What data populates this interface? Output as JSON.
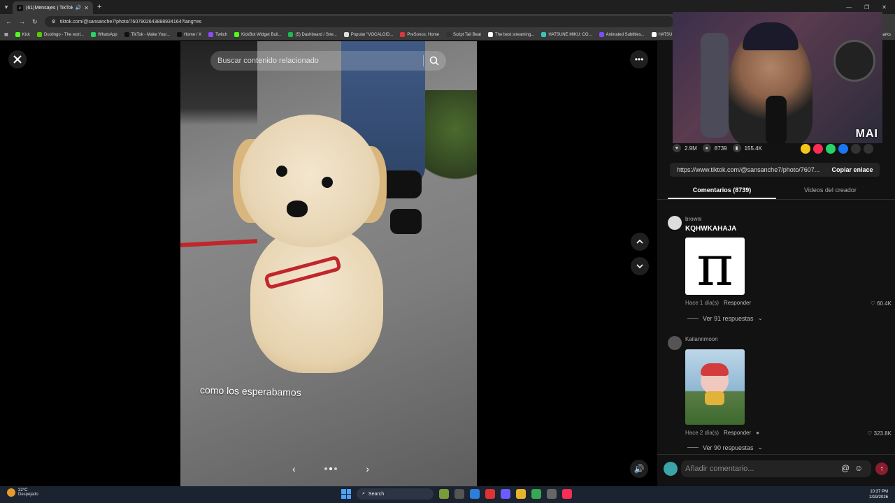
{
  "browser": {
    "tab_title": "(61)Mensajes | TikTok",
    "url": "tiktok.com/@sansanche7/photo/7607902643888934164?lang=es",
    "bookmarks": [
      {
        "label": "Kick",
        "color": "#53fc18"
      },
      {
        "label": "Duolingo - The worl...",
        "color": "#58cc02"
      },
      {
        "label": "WhatsApp",
        "color": "#25d366"
      },
      {
        "label": "TikTok - Make Your...",
        "color": "#111111"
      },
      {
        "label": "Home / X",
        "color": "#111111"
      },
      {
        "label": "Twitch",
        "color": "#9146ff"
      },
      {
        "label": "KickBot Widget Buil...",
        "color": "#53fc18"
      },
      {
        "label": "(5) Dashboard / Stre...",
        "color": "#1db954"
      },
      {
        "label": "Popular \"VOCALOID...",
        "color": "#dddddd"
      },
      {
        "label": "PreSonus: Home",
        "color": "#e0363b"
      },
      {
        "label": "Script Tail Beat",
        "color": "#333333"
      },
      {
        "label": "The best streaming...",
        "color": "#ffffff"
      },
      {
        "label": "HATSUNE MIKU: CO...",
        "color": "#39c5bb"
      },
      {
        "label": "Animated Subtitles...",
        "color": "#7a4dff"
      },
      {
        "label": "HATSUNE",
        "color": "#ffffff"
      }
    ],
    "bookmarks_overflow": "bookmarks"
  },
  "viewer": {
    "search_placeholder": "Buscar contenido relacionado",
    "caption": "como los esperabamos",
    "slide_dots": 3,
    "active_slide": 2
  },
  "panel": {
    "webcam_tag": "MAI",
    "stats": {
      "likes": "2.9M",
      "comments": "8739",
      "saves": "155.4K"
    },
    "share_colors": [
      "#f5c518",
      "#fe2c55",
      "#25d366",
      "#1877f2"
    ],
    "link_url": "https://www.tiktok.com/@sansanche7/photo/7607...",
    "copy_label": "Copiar enlace",
    "tabs": [
      "Comentarios (8739)",
      "Videos del creador"
    ],
    "comments": [
      {
        "user": "browni",
        "text": "KQHWKAHAJA",
        "media": "π",
        "time": "Hace 1 día(s)",
        "reply": "Responder",
        "likes": "60.4K",
        "replies": "Ver 91 respuestas"
      },
      {
        "user": "Kailannmoon",
        "text": "",
        "media": "",
        "time": "Hace 2 día(s)",
        "reply": "Responder",
        "likes": "323.8K",
        "replies": "Ver 90 respuestas"
      }
    ],
    "comment_placeholder": "Añadir comentario..."
  },
  "taskbar": {
    "temp": "22°C",
    "weather": "Despejado",
    "search": "Search",
    "time": "10:37 PM",
    "date": "2/19/2026"
  }
}
